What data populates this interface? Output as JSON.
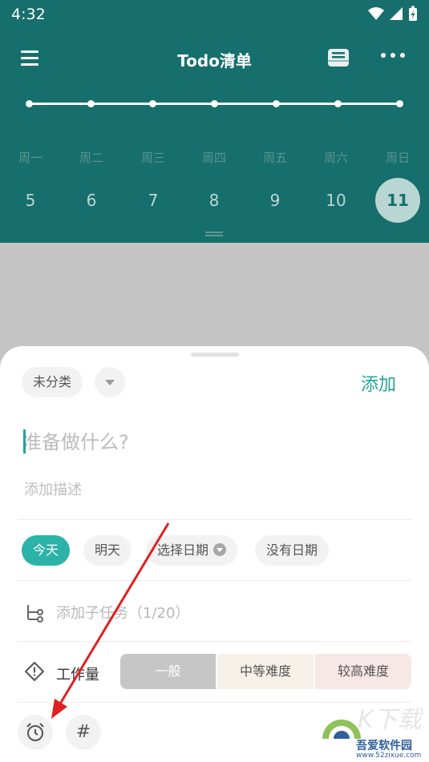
{
  "status_bar": {
    "time": "4:32"
  },
  "app_bar": {
    "title": "Todo清单"
  },
  "calendar": {
    "weekdays": [
      "周一",
      "周二",
      "周三",
      "周四",
      "周五",
      "周六",
      "周日"
    ],
    "dates": [
      "5",
      "6",
      "7",
      "8",
      "9",
      "10",
      "11"
    ],
    "selected_index": 6
  },
  "sheet": {
    "category_chip": "未分类",
    "add_label": "添加",
    "title_placeholder": "准备做什么?",
    "description_placeholder": "添加描述",
    "date_options": [
      "今天",
      "明天",
      "选择日期",
      "没有日期"
    ],
    "active_date_option": "今天",
    "subtask_label": "添加子任务（1/20）",
    "workload": {
      "label": "工作量",
      "options": [
        "一般",
        "中等难度",
        "较高难度"
      ],
      "selected": "一般"
    }
  },
  "watermark": {
    "text": "吾爱软件园",
    "url": "www.52zixue.com",
    "logo_text": "K下载"
  },
  "colors": {
    "header_bg": "#166f6c",
    "accent": "#2bb3a8",
    "add_text": "#23a399",
    "annotation_arrow": "#e02020"
  },
  "icons": {
    "menu": "hamburger-menu-icon",
    "archive": "archive-box-icon",
    "more": "more-horizontal-icon",
    "dropdown": "chevron-down-icon",
    "subtask": "subtask-tree-icon",
    "workload": "warning-diamond-icon",
    "alarm": "alarm-clock-icon",
    "tag": "hashtag-icon"
  }
}
